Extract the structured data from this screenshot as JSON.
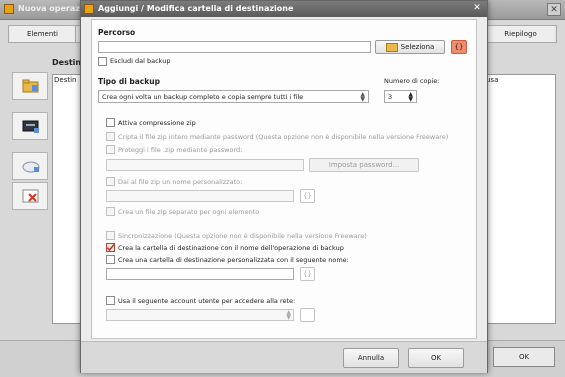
{
  "background_window": {
    "title": "Nuova operazio",
    "tab_elementi": "Elementi",
    "tab_riepilogo": "Riepilogo",
    "section_title": "Destin",
    "table_col_dest": "Destin",
    "table_col_usa": "usa",
    "ok_label": "OK",
    "close_label": "✕"
  },
  "dialog": {
    "title": "Aggiungi / Modifica cartella di destinazione",
    "close_label": "✕",
    "percorso_label": "Percorso",
    "percorso_value": "",
    "seleziona_label": "Seleziona",
    "brace_label": "{}",
    "escludi_label": "Escludi dal backup",
    "tipo_label": "Tipo di backup",
    "tipo_value": "Crea ogni volta un backup completo e copia sempre tutti i file",
    "num_copie_label": "Numero di copie:",
    "num_copie_value": "3",
    "zip_label": "Attiva compressione zip",
    "cripta_label": "Cripta il file zip intero mediante password (Questa opzione non è disponibile nella versione Freeware)",
    "proteggi_label": "Proteggi i file .zip mediante password:",
    "imposta_label": "Imposta password...",
    "dai_nome_label": "Dai al file zip un nome personalizzato:",
    "separato_label": "Crea un file zip separato per ogni elemento",
    "sincronizzazione_label": "Sincronizzazione (Questa opzione non è disponibile nella versione Freeware)",
    "crea_cartella_label": "Crea la cartella di destinazione con il nome dell'operazione di backup",
    "crea_personalizzata_label": "Crea una cartella di destinazione personalizzata con il seguente nome:",
    "account_label": "Usa il seguente account utente per accedere alla rete:",
    "annulla_label": "Annulla",
    "ok_label": "OK"
  },
  "colors": {
    "accent_red": "#f28a6c",
    "checked_red": "#b0443a",
    "folder_yellow": "#e8b84a"
  },
  "icons": [
    "warning-icon",
    "folder-icon",
    "add-folder-icon",
    "server-icon",
    "cloud-add-icon",
    "delete-icon"
  ]
}
